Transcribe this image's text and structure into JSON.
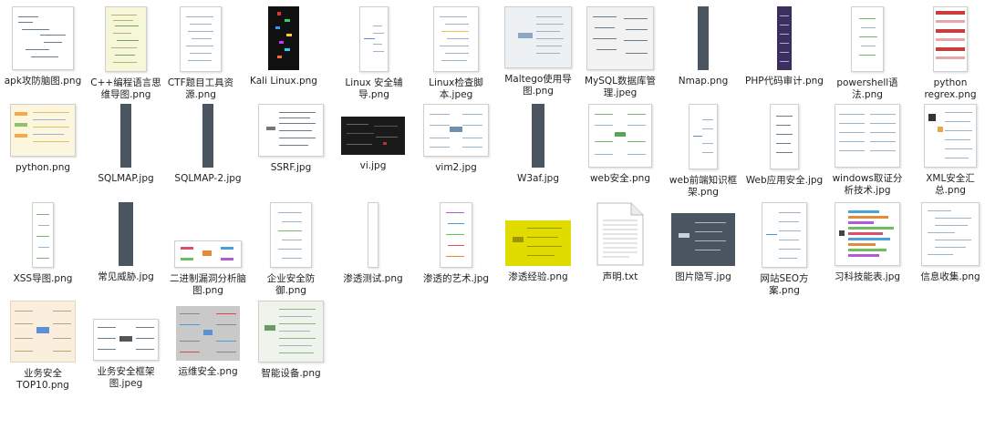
{
  "files": [
    {
      "name": "apk攻防脑图.png",
      "icon": "mindmap-thumbnail"
    },
    {
      "name": "C++编程语言思维导图.png",
      "icon": "mindmap-thumbnail"
    },
    {
      "name": "CTF题目工具资源.png",
      "icon": "mindmap-thumbnail"
    },
    {
      "name": "Kali Linux.png",
      "icon": "mindmap-thumbnail"
    },
    {
      "name": "Linux 安全辅导.png",
      "icon": "mindmap-thumbnail"
    },
    {
      "name": "Linux检查脚本.jpeg",
      "icon": "mindmap-thumbnail"
    },
    {
      "name": "Maltego使用导图.png",
      "icon": "mindmap-thumbnail"
    },
    {
      "name": "MySQL数据库管理.jpeg",
      "icon": "mindmap-thumbnail"
    },
    {
      "name": "Nmap.png",
      "icon": "mindmap-thumbnail"
    },
    {
      "name": "PHP代码审计.png",
      "icon": "mindmap-thumbnail"
    },
    {
      "name": "powershell语法.png",
      "icon": "mindmap-thumbnail"
    },
    {
      "name": "python regrex.png",
      "icon": "mindmap-thumbnail"
    },
    {
      "name": "python.png",
      "icon": "mindmap-thumbnail"
    },
    {
      "name": "SQLMAP.jpg",
      "icon": "mindmap-thumbnail"
    },
    {
      "name": "SQLMAP-2.jpg",
      "icon": "mindmap-thumbnail"
    },
    {
      "name": "SSRF.jpg",
      "icon": "mindmap-thumbnail"
    },
    {
      "name": "vi.jpg",
      "icon": "mindmap-thumbnail"
    },
    {
      "name": "vim2.jpg",
      "icon": "mindmap-thumbnail"
    },
    {
      "name": "W3af.jpg",
      "icon": "mindmap-thumbnail"
    },
    {
      "name": "web安全.png",
      "icon": "mindmap-thumbnail"
    },
    {
      "name": "web前端知识框架.png",
      "icon": "mindmap-thumbnail"
    },
    {
      "name": "Web应用安全.jpg",
      "icon": "mindmap-thumbnail"
    },
    {
      "name": "windows取证分析技术.jpg",
      "icon": "mindmap-thumbnail"
    },
    {
      "name": "XML安全汇总.png",
      "icon": "mindmap-thumbnail"
    },
    {
      "name": "XSS导图.png",
      "icon": "mindmap-thumbnail"
    },
    {
      "name": "常见威胁.jpg",
      "icon": "mindmap-thumbnail"
    },
    {
      "name": "二进制漏洞分析脑图.png",
      "icon": "mindmap-thumbnail"
    },
    {
      "name": "企业安全防御.png",
      "icon": "mindmap-thumbnail"
    },
    {
      "name": "渗透测试.png",
      "icon": "mindmap-thumbnail"
    },
    {
      "name": "渗透的艺术.jpg",
      "icon": "mindmap-thumbnail"
    },
    {
      "name": "渗透经验.png",
      "icon": "mindmap-thumbnail"
    },
    {
      "name": "声明.txt",
      "icon": "text-document-icon"
    },
    {
      "name": "图片隐写.jpg",
      "icon": "mindmap-thumbnail"
    },
    {
      "name": "网站SEO方案.png",
      "icon": "mindmap-thumbnail"
    },
    {
      "name": "习科技能表.jpg",
      "icon": "mindmap-thumbnail"
    },
    {
      "name": "信息收集.png",
      "icon": "mindmap-thumbnail"
    },
    {
      "name": "业务安全TOP10.png",
      "icon": "mindmap-thumbnail"
    },
    {
      "name": "业务安全框架图.jpeg",
      "icon": "mindmap-thumbnail"
    },
    {
      "name": "运维安全.png",
      "icon": "mindmap-thumbnail"
    },
    {
      "name": "智能设备.png",
      "icon": "mindmap-thumbnail"
    }
  ],
  "accent_colors": {
    "label_text": "#222222",
    "dark_thumb": "#4a5560",
    "yellow_thumb": "#e0dc00",
    "line": "#9db4c8"
  }
}
